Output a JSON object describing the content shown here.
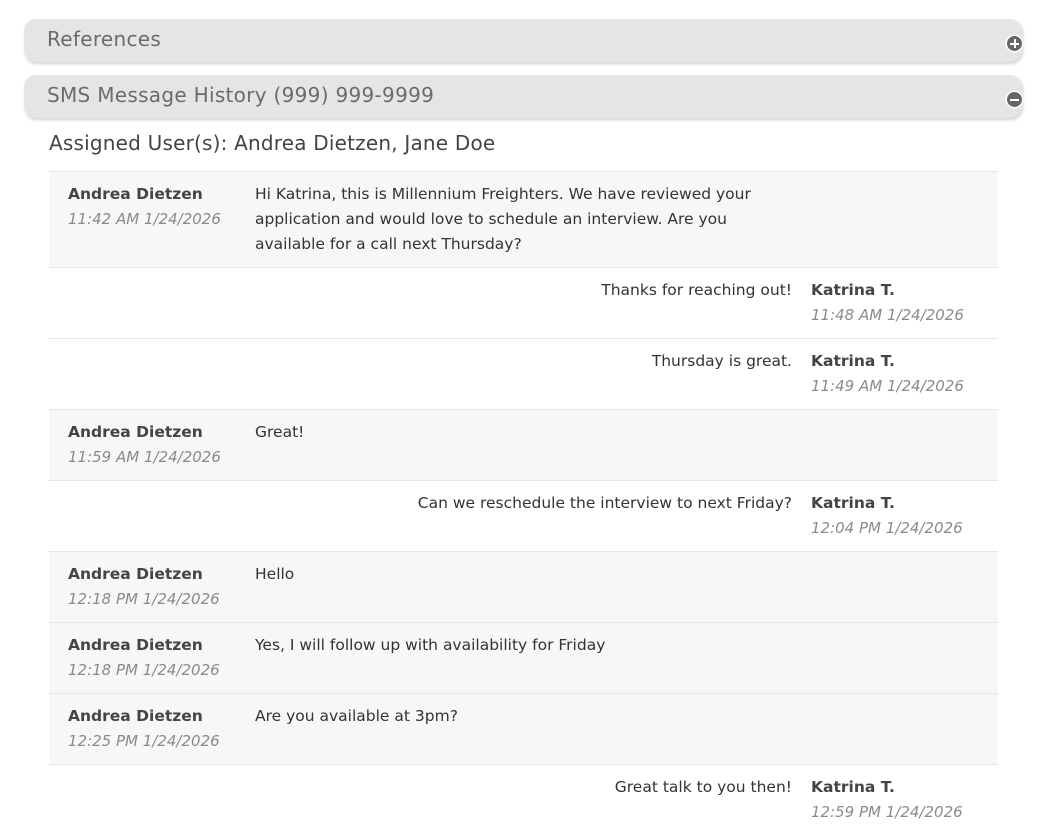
{
  "panels": {
    "references": {
      "title": "References",
      "icon": "plus-circle-icon"
    },
    "sms": {
      "title": "SMS Message History (999) 999-9999",
      "icon": "minus-circle-icon"
    }
  },
  "assigned_users": "Assigned User(s): Andrea Dietzen, Jane Doe",
  "messages": [
    {
      "direction": "inbound",
      "sender": "Andrea Dietzen",
      "time": "11:42 AM 1/24/2026",
      "text": "Hi Katrina, this is Millennium Freighters. We have reviewed your application and would love to schedule an interview. Are you available for a call next Thursday?"
    },
    {
      "direction": "outbound",
      "sender": "Katrina T.",
      "time": "11:48 AM 1/24/2026",
      "text": "Thanks for reaching out!"
    },
    {
      "direction": "outbound",
      "sender": "Katrina T.",
      "time": "11:49 AM 1/24/2026",
      "text": "Thursday is great."
    },
    {
      "direction": "inbound",
      "sender": "Andrea Dietzen",
      "time": "11:59 AM 1/24/2026",
      "text": "Great!"
    },
    {
      "direction": "outbound",
      "sender": "Katrina T.",
      "time": "12:04 PM 1/24/2026",
      "text": "Can we reschedule the interview to next Friday?"
    },
    {
      "direction": "inbound",
      "sender": "Andrea Dietzen",
      "time": "12:18 PM 1/24/2026",
      "text": "Hello"
    },
    {
      "direction": "inbound",
      "sender": "Andrea Dietzen",
      "time": "12:18 PM 1/24/2026",
      "text": "Yes, I will follow up with availability for Friday"
    },
    {
      "direction": "inbound",
      "sender": "Andrea Dietzen",
      "time": "12:25 PM 1/24/2026",
      "text": "Are you available at 3pm?"
    },
    {
      "direction": "outbound",
      "sender": "Katrina T.",
      "time": "12:59 PM 1/24/2026",
      "text": "Great talk to you then!"
    }
  ],
  "colors": {
    "panel_bg": "#e5e5e5",
    "inbound_bg": "#f6f7f9",
    "outbound_bg": "#ffffff",
    "divider": "#e3e6ea",
    "icon": "#666666"
  }
}
